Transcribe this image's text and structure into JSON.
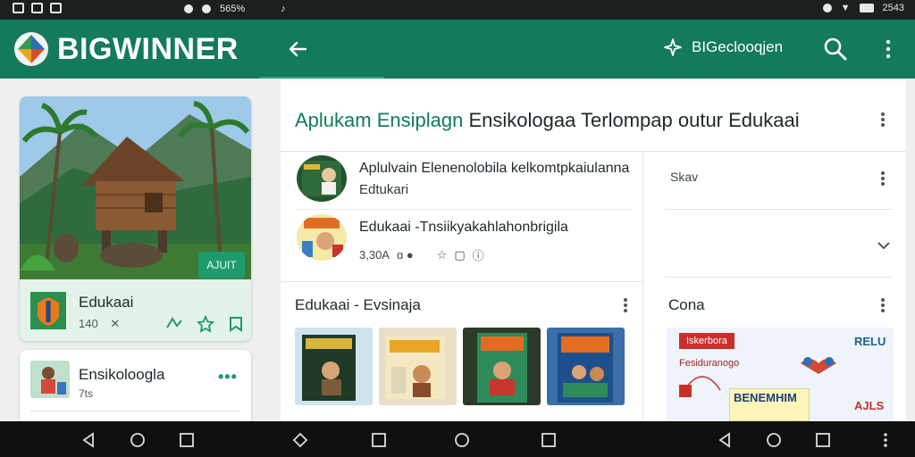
{
  "status_bar": {
    "left_text": "565%",
    "right_text": "2543"
  },
  "app_bar": {
    "brand": "BIGWINNER",
    "action_label": "BIGeclooqjen"
  },
  "left_column": {
    "hero_badge": "AJUIT",
    "card1": {
      "title": "Edukaai",
      "meta": "140"
    },
    "card2": {
      "title": "Ensikoloogla",
      "meta": "7ts"
    }
  },
  "main": {
    "title_accent": "Aplukam Ensiplagn",
    "title_rest": " Ensikologaa Terlompap outur Edukaai",
    "rows": [
      {
        "title": "Aplulvain Elenenolobila kelkomtpkaiulanna",
        "sub": "Edtukari"
      },
      {
        "title": "Edukaai -Tnsiikyakahlahonbrigila",
        "meta": "3,30A"
      }
    ],
    "right_top_label": "Skav",
    "section_left_title": "Edukaai  -  Evsinaja",
    "section_right_title": "Cona",
    "promo": {
      "tag": "Iskerbora",
      "corner": "RELU",
      "text": "Fesiduranogo",
      "banner": "BENEMHIM",
      "side": "AJLS"
    }
  },
  "colors": {
    "primary": "#137a5b",
    "accent": "#1e9a6c",
    "statusbar": "#1b1f1d"
  }
}
